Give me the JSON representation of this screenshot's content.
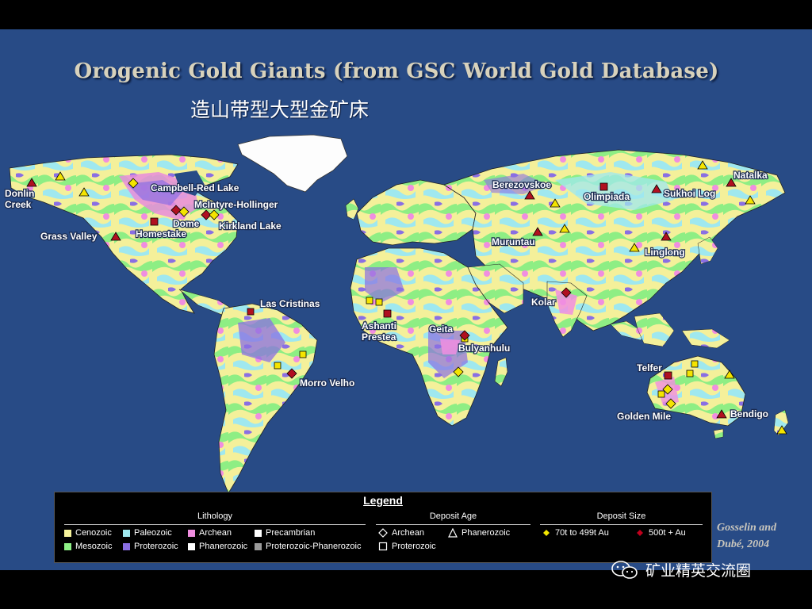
{
  "title": "Orogenic Gold Giants (from GSC World Gold Database)",
  "subtitle": "造山带型大型金矿床",
  "deposit_labels": [
    "Donlin Creek",
    "Campbell-Red Lake",
    "McIntyre-Hollinger",
    "Dome",
    "Kirkland Lake",
    "Homestake",
    "Grass Valley",
    "Las Cristinas",
    "Morro Velho",
    "Ashanti Prestea",
    "Geita",
    "Bulyanhulu",
    "Berezovskoe",
    "Olimpiada",
    "Sukhoi Log",
    "Natalka",
    "Muruntau",
    "Linglong",
    "Kolar",
    "Telfer",
    "Golden Mile",
    "Bendigo"
  ],
  "legend": {
    "title": "Legend",
    "lithology_title": "Lithology",
    "lithology": [
      {
        "label": "Cenozoic",
        "color": "#f6f29a"
      },
      {
        "label": "Paleozoic",
        "color": "#9fe8ef"
      },
      {
        "label": "Archean",
        "color": "#f08ee0"
      },
      {
        "label": "Precambrian",
        "color": "#ffffff"
      },
      {
        "label": "Mesozoic",
        "color": "#8ef086"
      },
      {
        "label": "Proterozoic",
        "color": "#8a6fe3"
      },
      {
        "label": "Phanerozoic",
        "color": "#ffffff"
      },
      {
        "label": "Proterozoic-Phanerozoic",
        "color": "#9b9b9b"
      }
    ],
    "age_title": "Deposit Age",
    "age": [
      {
        "label": "Archean",
        "icon": "diamond-outline-icon"
      },
      {
        "label": "Phanerozoic",
        "icon": "triangle-outline-icon"
      },
      {
        "label": "Proterozoic",
        "icon": "square-outline-icon"
      }
    ],
    "size_title": "Deposit Size",
    "size": [
      {
        "label": "70t to 499t Au",
        "color": "#f2e600"
      },
      {
        "label": "500t + Au",
        "color": "#c0001c"
      }
    ]
  },
  "credit_line1": "Gosselin and",
  "credit_line2": "Dubé, 2004",
  "watermark": "矿业精英交流圈"
}
